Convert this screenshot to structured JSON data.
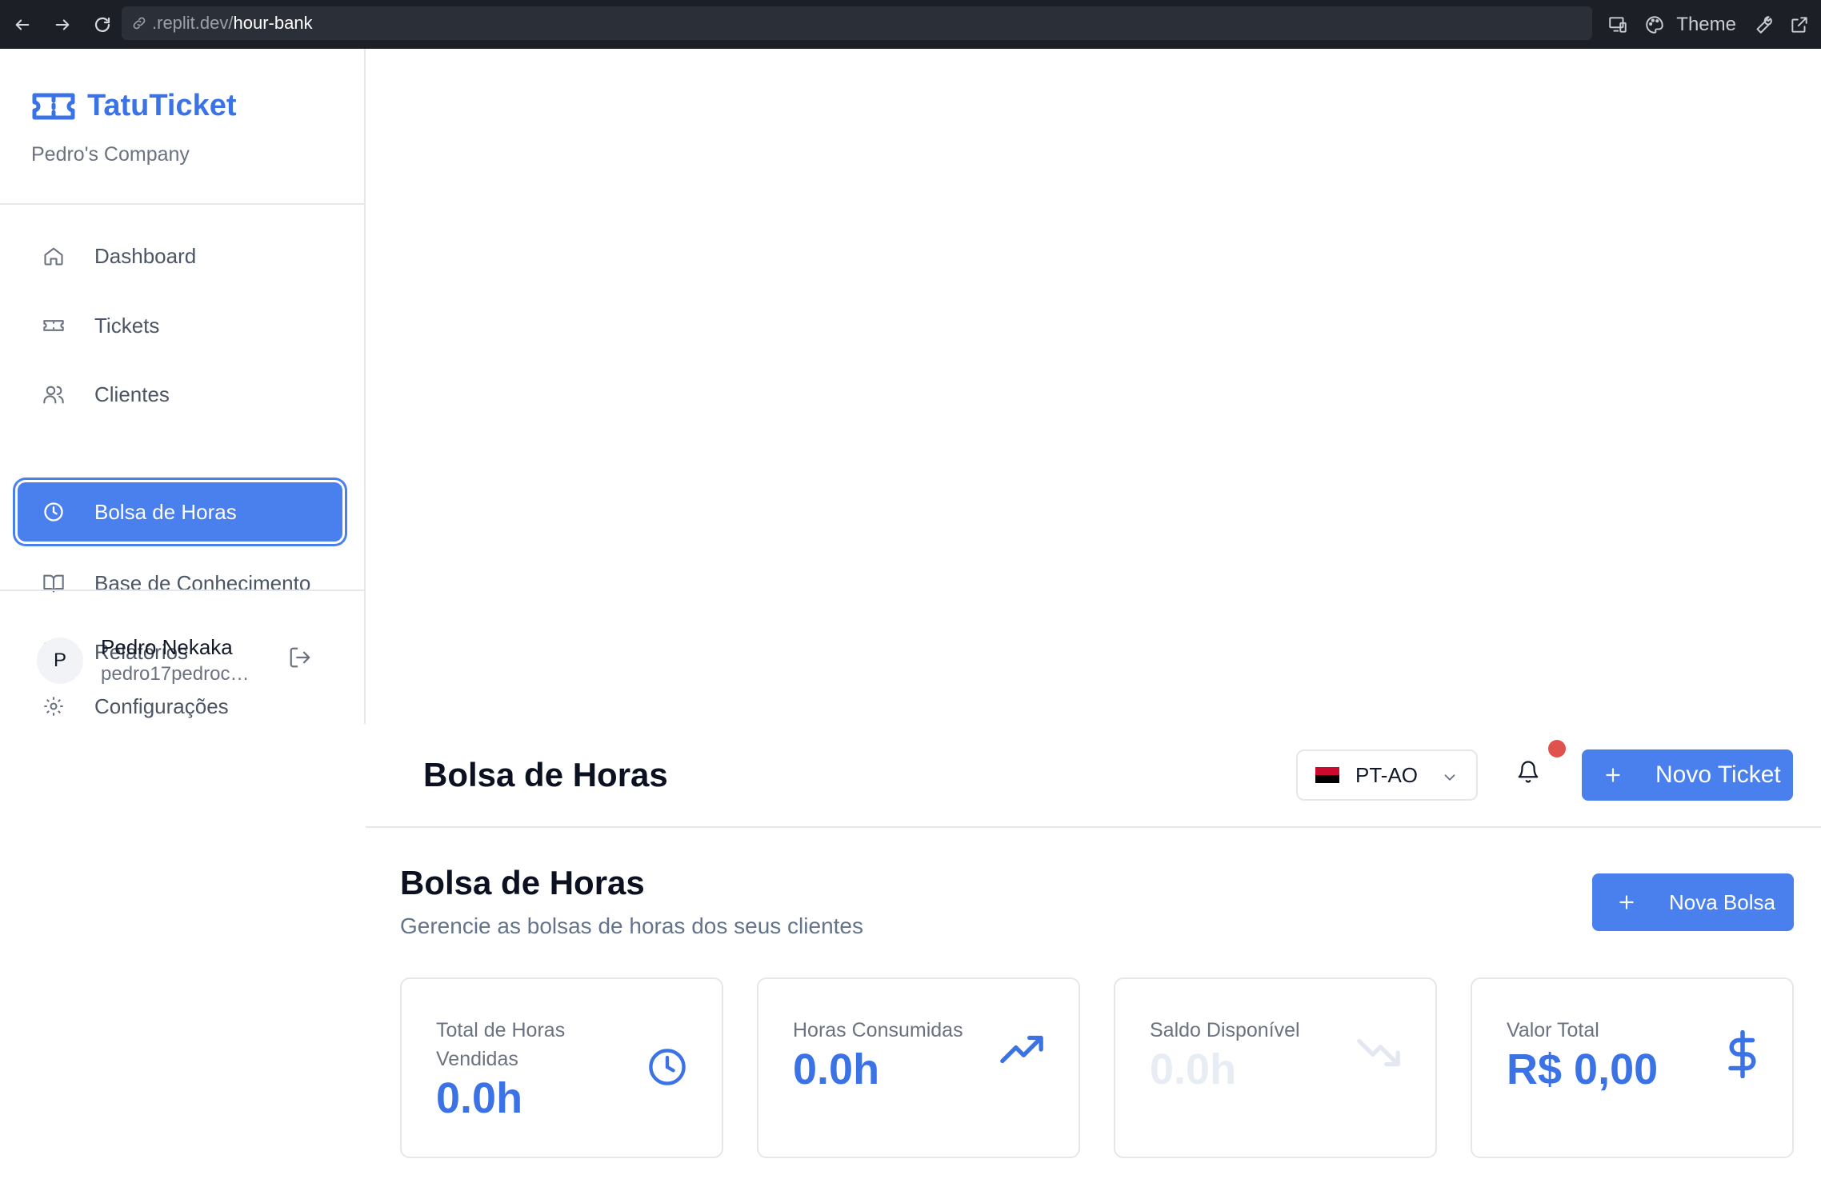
{
  "browser": {
    "url_prefix": ".replit.dev/",
    "url_path": "hour-bank",
    "theme_label": "Theme"
  },
  "sidebar": {
    "brand": "TatuTicket",
    "company": "Pedro's Company",
    "items": [
      {
        "label": "Dashboard",
        "icon": "home-icon"
      },
      {
        "label": "Tickets",
        "icon": "ticket-icon"
      },
      {
        "label": "Clientes",
        "icon": "users-icon"
      },
      {
        "label": "Bolsa de Horas",
        "icon": "clock-icon",
        "active": true
      },
      {
        "label": "Base de Conhecimento",
        "icon": "book-icon"
      },
      {
        "label": "Relatórios",
        "icon": "bar-chart-icon"
      },
      {
        "label": "Configurações",
        "icon": "gear-icon"
      }
    ],
    "user": {
      "initial": "P",
      "name": "Pedro Nekaka",
      "email": "pedro17pedroc@..."
    }
  },
  "header": {
    "title": "Bolsa de Horas",
    "language": "PT-AO",
    "new_ticket_label": "Novo Ticket"
  },
  "main": {
    "title": "Bolsa de Horas",
    "subtitle": "Gerencie as bolsas de horas dos seus clientes",
    "new_bag_label": "Nova Bolsa",
    "stats": [
      {
        "label": "Total de Horas Vendidas",
        "value": "0.0h",
        "icon": "clock-icon"
      },
      {
        "label": "Horas Consumidas",
        "value": "0.0h",
        "icon": "trending-up-icon"
      },
      {
        "label": "Saldo Disponível",
        "value": "0.0h",
        "icon": "trending-down-icon"
      },
      {
        "label": "Valor Total",
        "value": "R$ 0,00",
        "icon": "dollar-icon"
      }
    ]
  },
  "colors": {
    "accent": "#4a80ee",
    "brand": "#3b73e6",
    "notification": "#e0524d",
    "chrome": "#1c1f26"
  }
}
